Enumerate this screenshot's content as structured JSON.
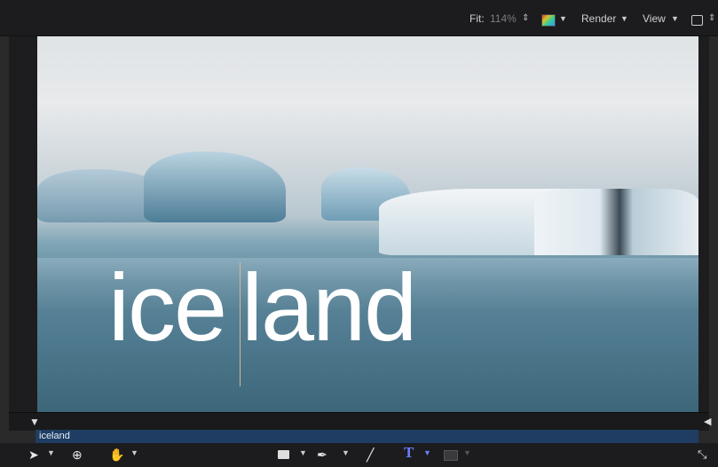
{
  "topbar": {
    "fit_label": "Fit:",
    "fit_value": "114%",
    "render_label": "Render",
    "view_label": "View",
    "icons": [
      "updown-icon",
      "color-swatch-icon",
      "chevron-down-icon",
      "layout-icon"
    ]
  },
  "canvas": {
    "title_part1": "ice",
    "title_part2": "land"
  },
  "timeline": {
    "track_label": "iceland"
  },
  "toolbar": {
    "tools": [
      "select-arrow-icon",
      "transform-orbit-icon",
      "hand-pan-icon",
      "rectangle-shape-icon",
      "bezier-pen-icon",
      "paint-brush-icon",
      "text-tool-icon",
      "mask-icon"
    ]
  }
}
